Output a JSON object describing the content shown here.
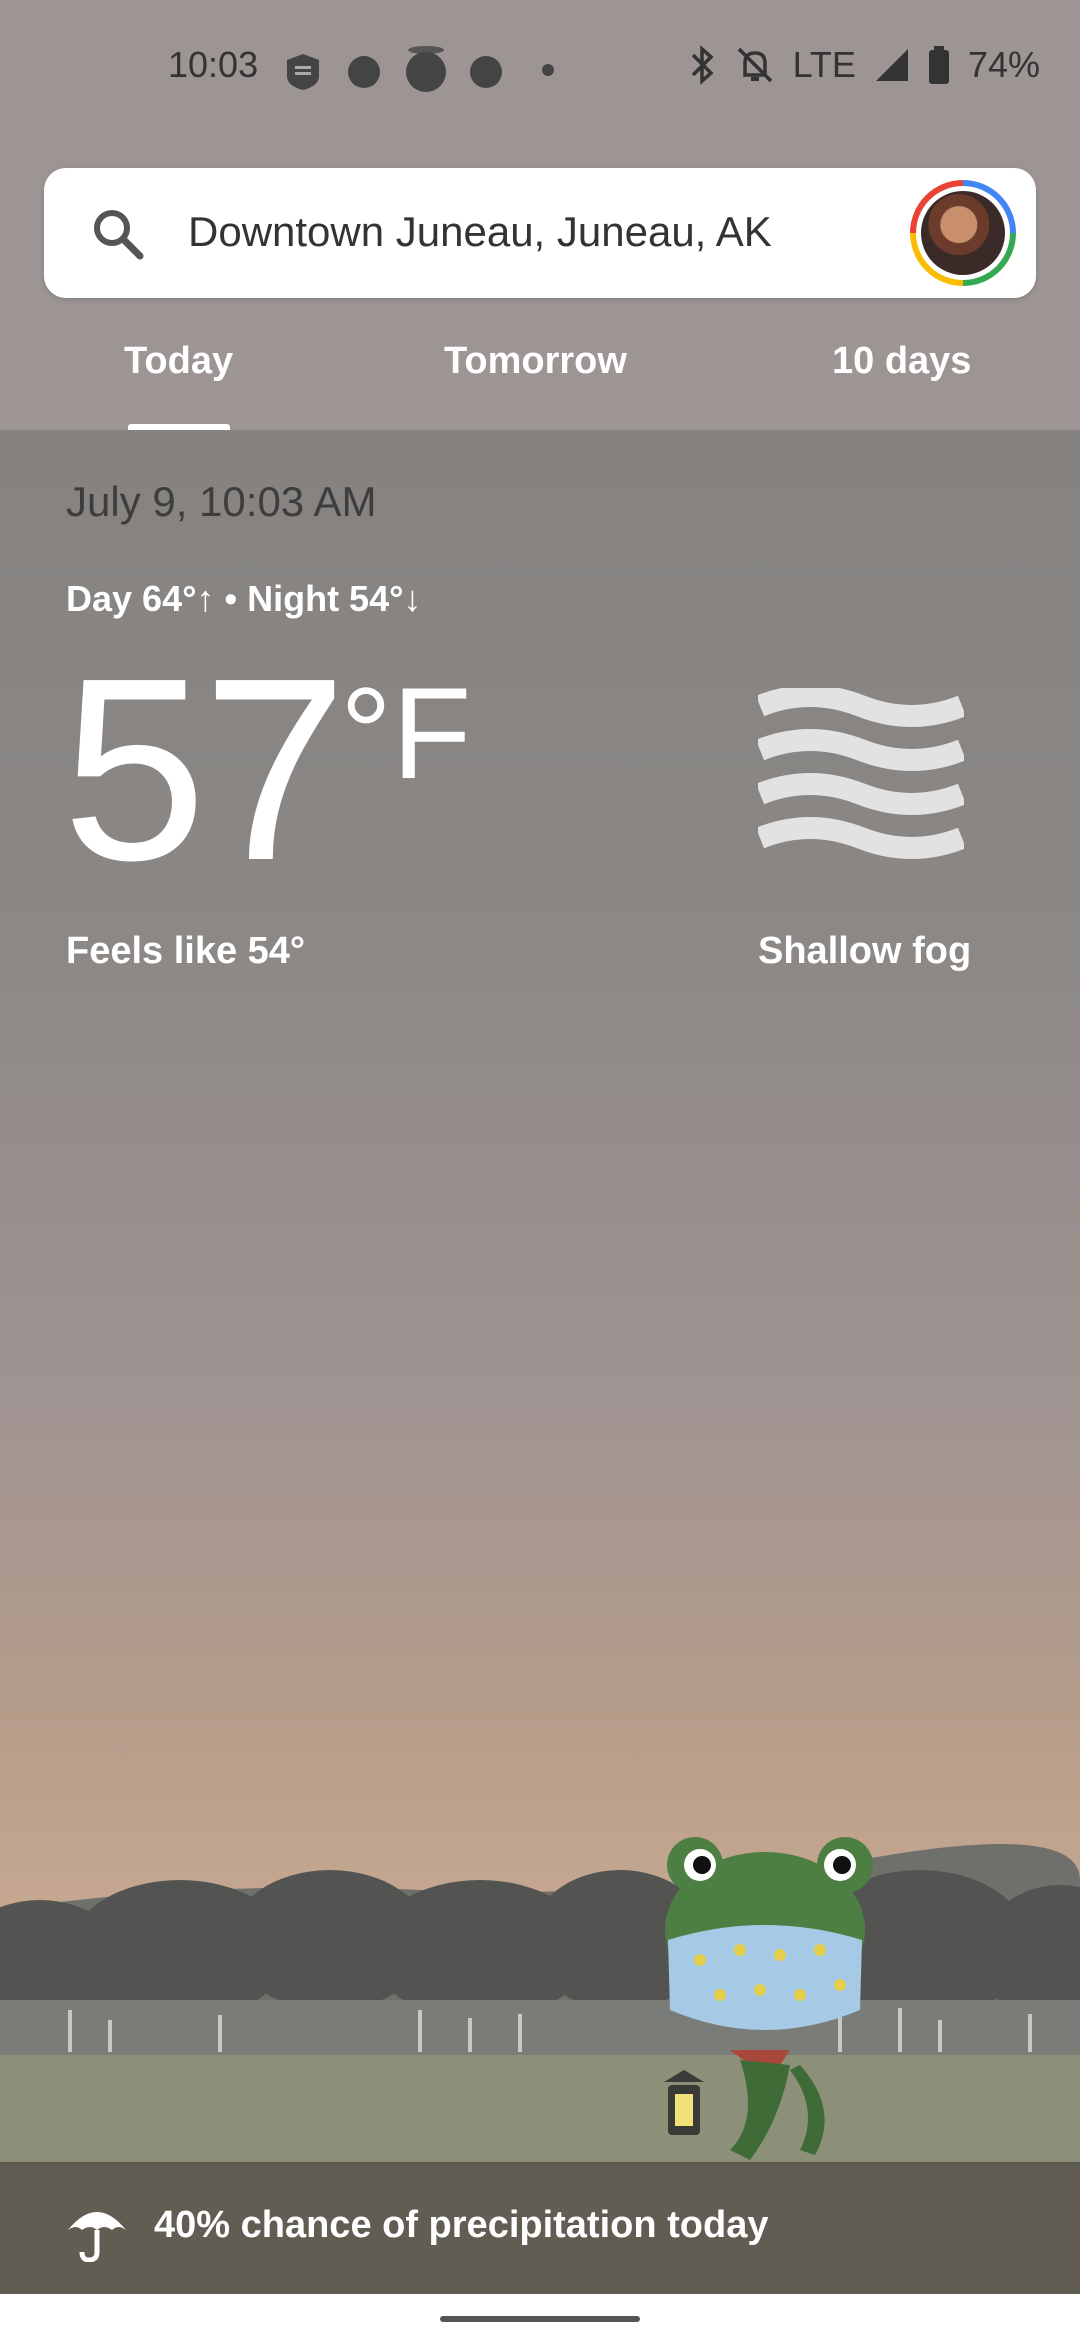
{
  "status": {
    "time": "10:03",
    "network": "LTE",
    "battery": "74%"
  },
  "search": {
    "location": "Downtown Juneau, Juneau, AK"
  },
  "tabs": [
    {
      "label": "Today",
      "selected": true
    },
    {
      "label": "Tomorrow",
      "selected": false
    },
    {
      "label": "10 days",
      "selected": false
    }
  ],
  "weather": {
    "datetime": "July 9, 10:03 AM",
    "day_night": "Day 64°↑ • Night 54°↓",
    "temperature": "57",
    "unit": "°F",
    "feels_like": "Feels like 54°",
    "condition": "Shallow fog"
  },
  "precipitation": {
    "text": "40% chance of precipitation today"
  },
  "colors": {
    "accent_white": "#ffffff",
    "sky_top": "#858280",
    "sky_bottom": "#c7a994"
  }
}
